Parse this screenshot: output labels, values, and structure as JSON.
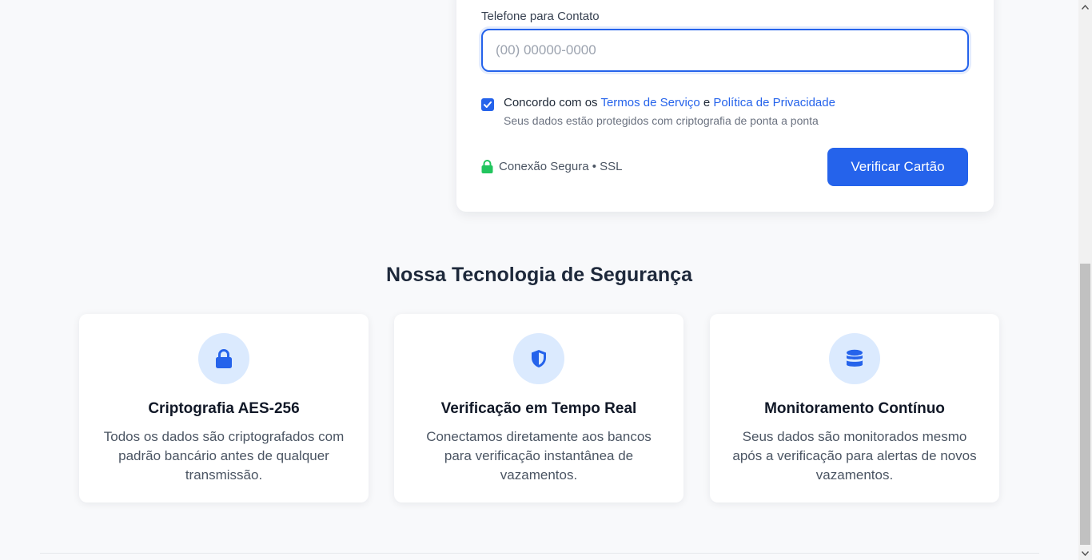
{
  "form": {
    "phone_label": "Telefone para Contato",
    "phone_placeholder": "(00) 00000-0000",
    "phone_value": "",
    "consent_checked": true,
    "consent_prefix": "Concordo com os",
    "terms_link": "Termos de Serviço",
    "consent_and": "e",
    "privacy_link": "Política de Privacidade",
    "consent_note": "Seus dados estão protegidos com criptografia de ponta a ponta",
    "secure_label": "Conexão Segura • SSL",
    "submit_label": "Verificar Cartão"
  },
  "security": {
    "title": "Nossa Tecnologia de Segurança",
    "features": [
      {
        "icon": "lock-icon",
        "title": "Criptografia AES-256",
        "description": "Todos os dados são criptografados com padrão bancário antes de qualquer transmissão."
      },
      {
        "icon": "shield-icon",
        "title": "Verificação em Tempo Real",
        "description": "Conectamos diretamente aos bancos para verificação instantânea de vazamentos."
      },
      {
        "icon": "database-icon",
        "title": "Monitoramento Contínuo",
        "description": "Seus dados são monitorados mesmo após a verificação para alertas de novos vazamentos."
      }
    ]
  },
  "colors": {
    "accent": "#2563eb",
    "secure_green": "#22c55e",
    "icon_bg": "#dbeafe"
  }
}
